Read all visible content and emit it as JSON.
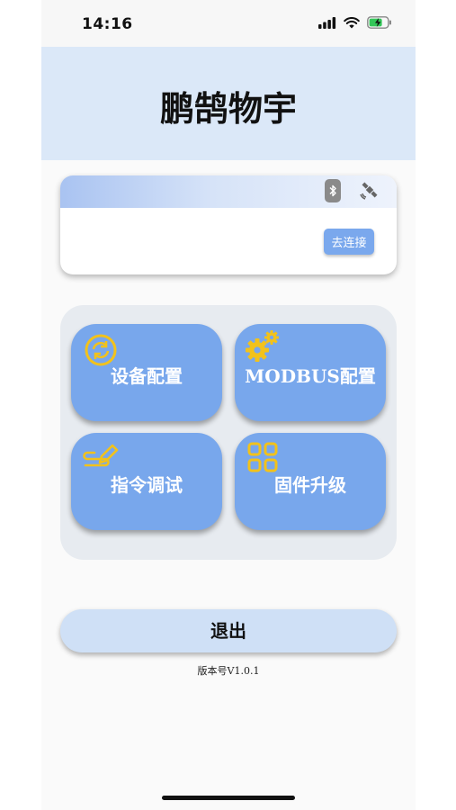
{
  "status_bar": {
    "time": "14:16",
    "icons": [
      "cellular-signal-icon",
      "wifi-icon",
      "battery-charging-icon"
    ]
  },
  "header": {
    "title": "鹏鹄物宇"
  },
  "connection_card": {
    "icons": [
      "bluetooth-icon",
      "satellite-icon"
    ],
    "connect_label": "去连接"
  },
  "menu": {
    "items": [
      {
        "label": "设备配置",
        "icon": "refresh-circle-icon"
      },
      {
        "label": "MODBUS配置",
        "icon": "gears-icon"
      },
      {
        "label": "指令调试",
        "icon": "pencil-squiggle-icon"
      },
      {
        "label": "固件升级",
        "icon": "grid-icon"
      }
    ]
  },
  "logout_label": "退出",
  "version": "版本号V1.0.1",
  "colors": {
    "header_bg": "#dbe8f8",
    "menu_button": "#78a7ec",
    "icon_gold": "#f2c21b",
    "connect_button": "#7aa8ed",
    "logout_bg": "#cfe0f6"
  }
}
